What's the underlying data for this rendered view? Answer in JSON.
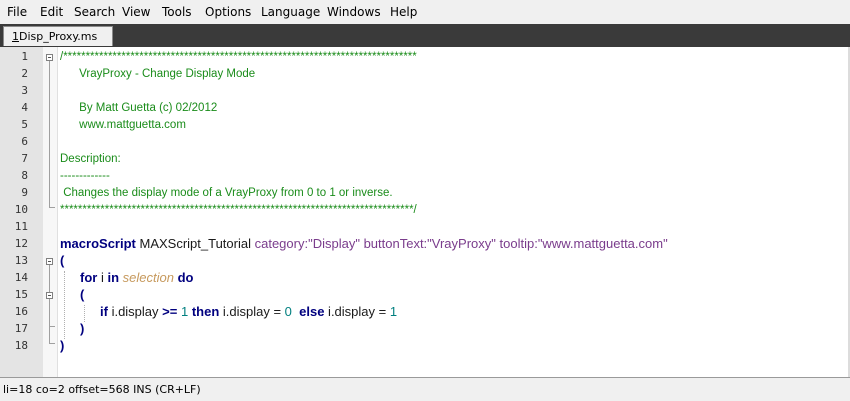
{
  "menu": [
    "File",
    "Edit",
    "Search",
    "View",
    "Tools",
    "Options",
    "Language",
    "Windows",
    "Help"
  ],
  "tab": {
    "number": "1",
    "name": "Disp_Proxy.ms"
  },
  "line_numbers": [
    "1",
    "2",
    "3",
    "4",
    "5",
    "6",
    "7",
    "8",
    "9",
    "10",
    "11",
    "12",
    "13",
    "14",
    "15",
    "16",
    "17",
    "18"
  ],
  "code": {
    "l1": "/*******************************************************************************",
    "l2": "      VrayProxy - Change Display Mode",
    "l4": "      By Matt Guetta (c) 02/2012",
    "l5": "      www.mattguetta.com",
    "l7": "Description:",
    "l8": "-------------",
    "l9": " Changes the display mode of a VrayProxy from 0 to 1 or inverse.",
    "l10": "*******************************************************************************/",
    "l12_kw": "macroScript",
    "l12_name": " MAXScript_Tutorial ",
    "l12_p1": "category:",
    "l12_s1": "\"Display\"",
    "l12_p2": " buttonText:",
    "l12_s2": "\"VrayProxy\"",
    "l12_p3": " tooltip:",
    "l12_s3": "\"www.mattguetta.com\"",
    "l13": "(",
    "l14_for": "for",
    "l14_i": " i ",
    "l14_in": "in",
    "l14_sel": " selection ",
    "l14_do": "do",
    "l15": "(",
    "l16_if": "if",
    "l16_a": " i.display ",
    "l16_op": ">=",
    "l16_n1": " 1 ",
    "l16_then": "then",
    "l16_b": " i.display = ",
    "l16_n0": "0",
    "l16_else": "  else",
    "l16_c": " i.display = ",
    "l16_n2": "1",
    "l17": ")",
    "l18": ")"
  },
  "status": "li=18 co=2 offset=568 INS (CR+LF)"
}
